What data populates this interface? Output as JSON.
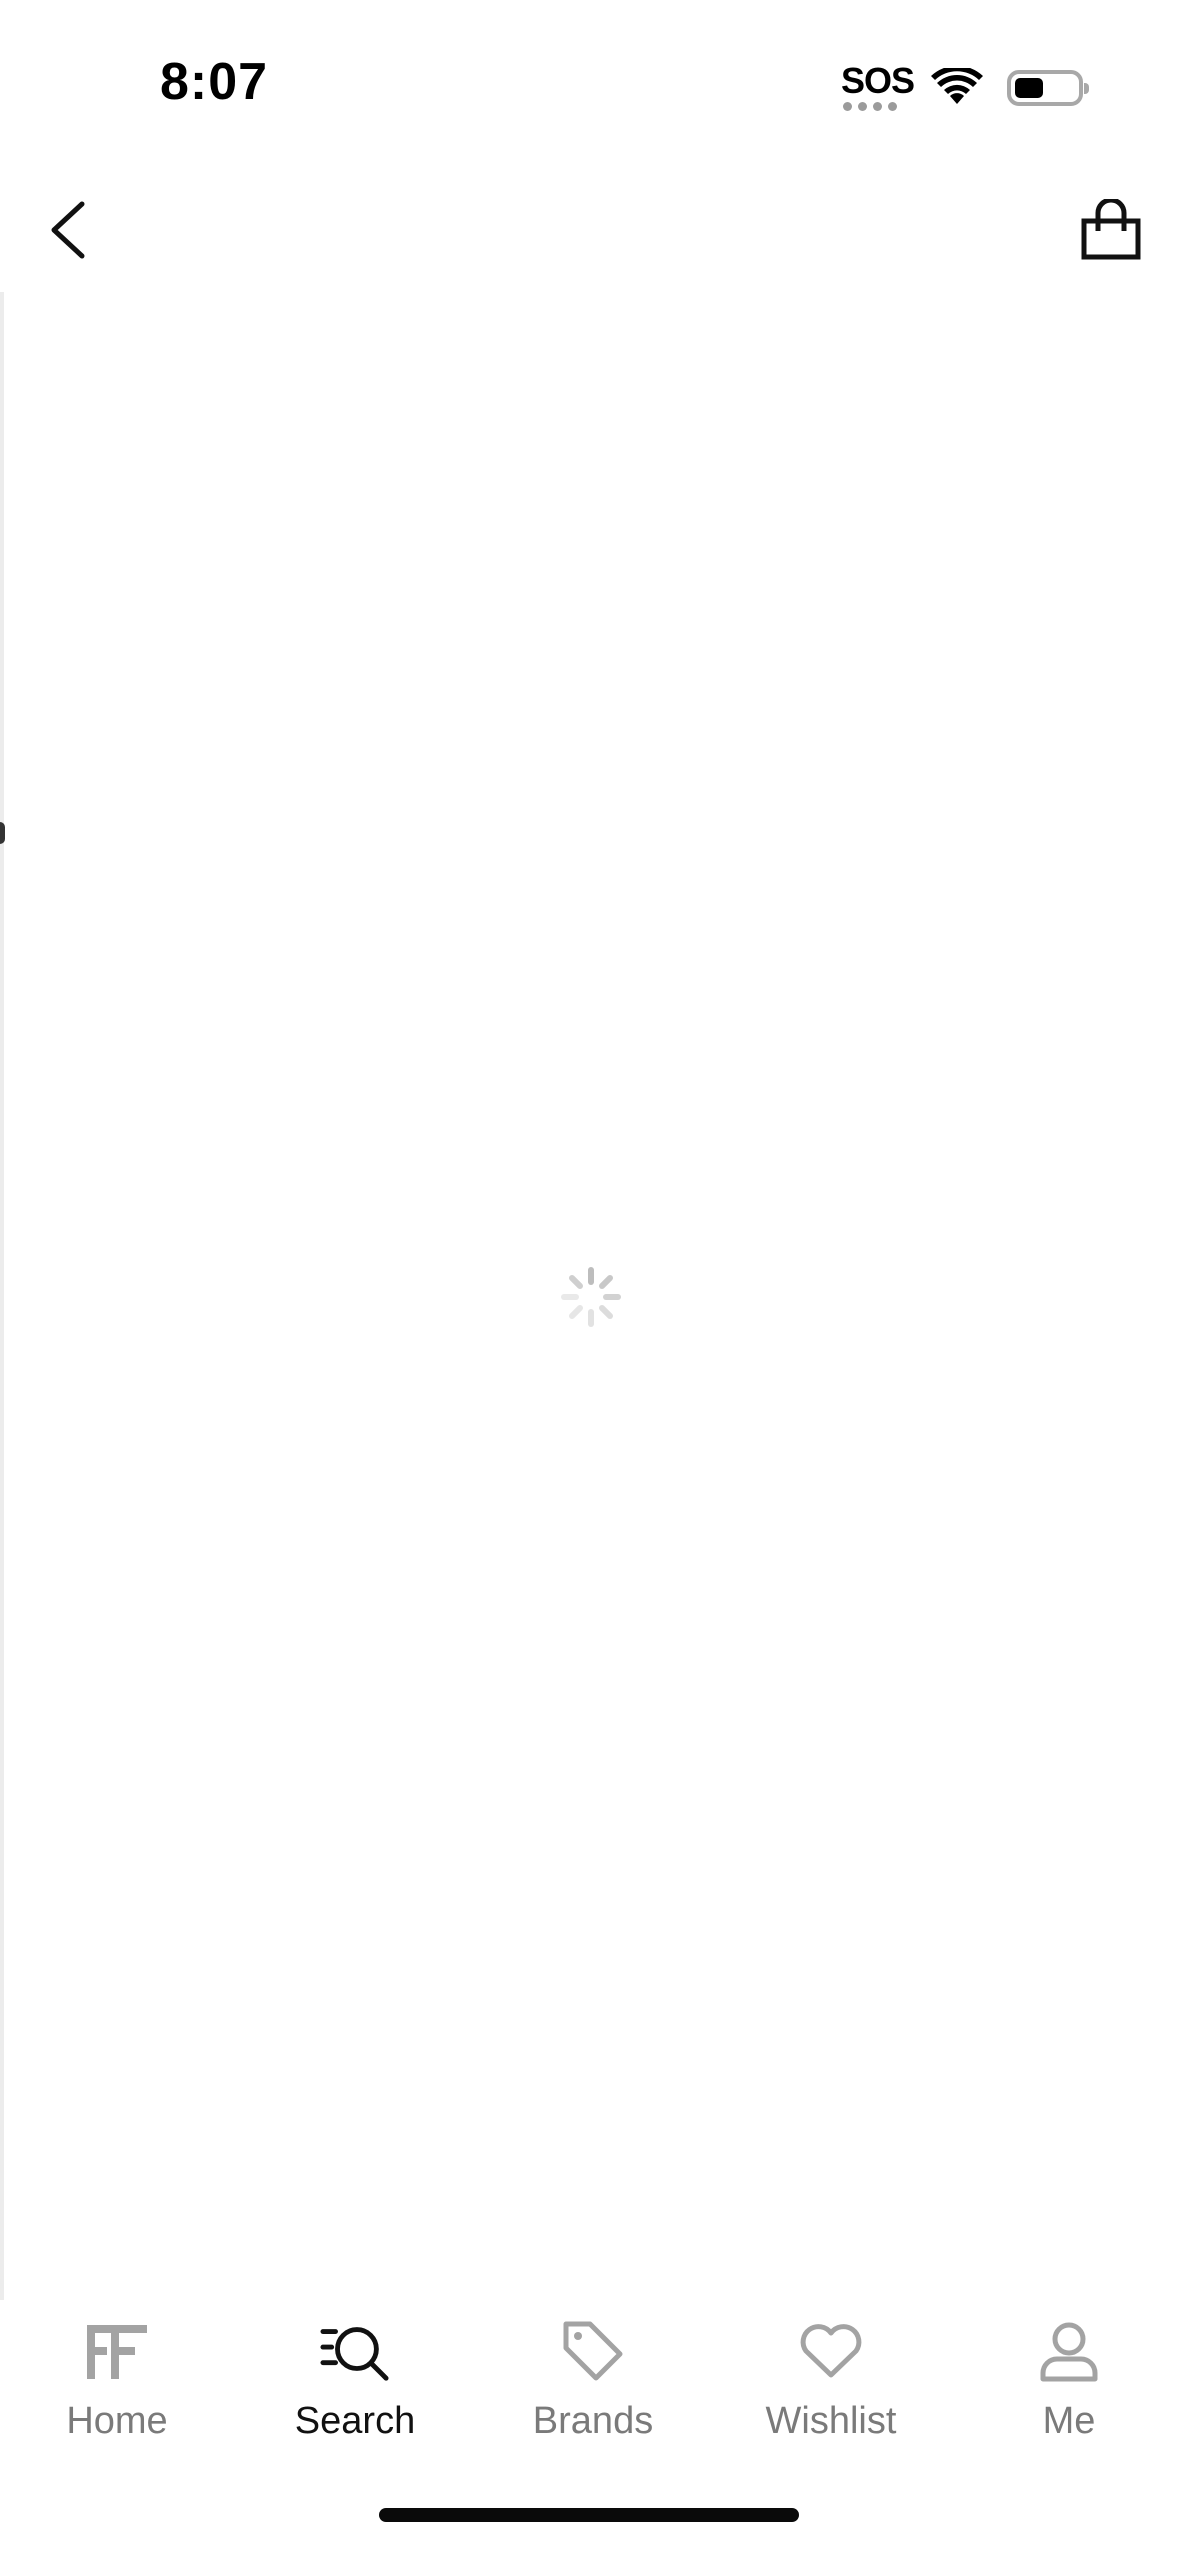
{
  "status_bar": {
    "time": "8:07",
    "sos_label": "SOS",
    "icons": [
      "sos-indicator",
      "wifi-icon",
      "battery-icon"
    ]
  },
  "nav": {
    "icons": [
      "back-chevron-icon",
      "shopping-bag-icon"
    ]
  },
  "content": {
    "state": "loading",
    "icon": "loading-spinner-icon"
  },
  "tab_bar": {
    "active": "search",
    "tabs": [
      {
        "id": "home",
        "label": "Home",
        "icon": "ff-logo-icon"
      },
      {
        "id": "search",
        "label": "Search",
        "icon": "search-icon"
      },
      {
        "id": "brands",
        "label": "Brands",
        "icon": "tag-icon"
      },
      {
        "id": "wishlist",
        "label": "Wishlist",
        "icon": "heart-icon"
      },
      {
        "id": "me",
        "label": "Me",
        "icon": "user-icon"
      }
    ]
  },
  "colors": {
    "active": "#111111",
    "inactive": "#7a7a7a",
    "icon_inactive": "#a3a3a3",
    "background": "#ffffff"
  }
}
